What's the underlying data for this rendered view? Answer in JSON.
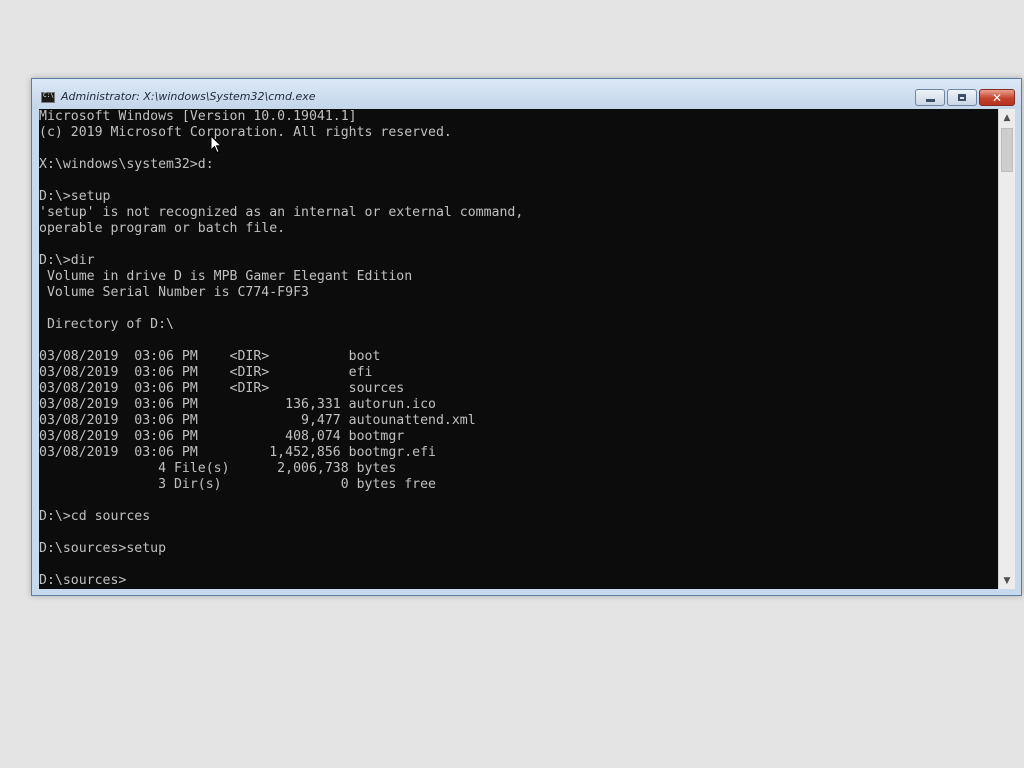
{
  "window": {
    "title": "Administrator: X:\\windows\\System32\\cmd.exe"
  },
  "controls": {
    "minimize_icon": "minimize-icon",
    "maximize_icon": "maximize-icon",
    "close_icon": "close-icon",
    "close_glyph": "✕",
    "scroll_up_glyph": "▲",
    "scroll_down_glyph": "▼"
  },
  "console": {
    "lines": [
      "Microsoft Windows [Version 10.0.19041.1]",
      "(c) 2019 Microsoft Corporation. All rights reserved.",
      "",
      "X:\\windows\\system32>d:",
      "",
      "D:\\>setup",
      "'setup' is not recognized as an internal or external command,",
      "operable program or batch file.",
      "",
      "D:\\>dir",
      " Volume in drive D is MPB Gamer Elegant Edition",
      " Volume Serial Number is C774-F9F3",
      "",
      " Directory of D:\\",
      "",
      "03/08/2019  03:06 PM    <DIR>          boot",
      "03/08/2019  03:06 PM    <DIR>          efi",
      "03/08/2019  03:06 PM    <DIR>          sources",
      "03/08/2019  03:06 PM           136,331 autorun.ico",
      "03/08/2019  03:06 PM             9,477 autounattend.xml",
      "03/08/2019  03:06 PM           408,074 bootmgr",
      "03/08/2019  03:06 PM         1,452,856 bootmgr.efi",
      "               4 File(s)      2,006,738 bytes",
      "               3 Dir(s)               0 bytes free",
      "",
      "D:\\>cd sources",
      "",
      "D:\\sources>setup",
      "",
      "D:\\sources>"
    ]
  },
  "colors": {
    "console_bg": "#0c0c0c",
    "console_fg": "#c0c0c0",
    "close_button": "#c6432c"
  }
}
